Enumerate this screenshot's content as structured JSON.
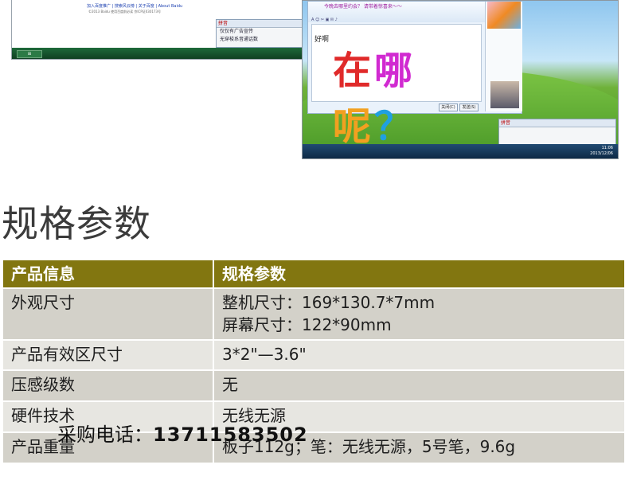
{
  "screenshot_left": {
    "footer_links": "加入百度推广 | 搜索风云榜 | 关于百度 | About Baidu",
    "copyright": "©2013 Baidu 使用百度前必读 京ICP证030173号",
    "ime_rows": [
      "仅仅有广告宣传",
      "无穿梭系音通话数"
    ],
    "ime_bar": "拼音"
  },
  "screenshot_right": {
    "chat_header": "今晚去哪里约会？ 请带着惊喜来～～",
    "greeting": "好啊",
    "handwriting": "在哪呢？",
    "clock_time": "11:06",
    "clock_date": "2013/12/06",
    "send_label": "发送(S)",
    "close_label": "关闭(C)"
  },
  "section": {
    "title": "规格参数"
  },
  "spec_table": {
    "headers": [
      "产品信息",
      "规格参数"
    ],
    "rows": [
      {
        "label": "外观尺寸",
        "values": [
          "整机尺寸：169*130.7*7mm",
          "屏幕尺寸：122*90mm"
        ]
      },
      {
        "label": "产品有效区尺寸",
        "values": [
          "3*2\"—3.6\""
        ]
      },
      {
        "label": "压感级数",
        "values": [
          "无"
        ]
      },
      {
        "label": "硬件技术",
        "values": [
          "无线无源"
        ]
      },
      {
        "label": "产品重量",
        "values": [
          "板子112g；笔：无线无源，5号笔，9.6g"
        ]
      }
    ]
  },
  "overlay": {
    "label": "采购电话：",
    "phone": "13711583502"
  },
  "colors": {
    "header_bg": "#827610",
    "row_bg": "#d3d1c9",
    "row_alt_bg": "#e7e6e1"
  }
}
